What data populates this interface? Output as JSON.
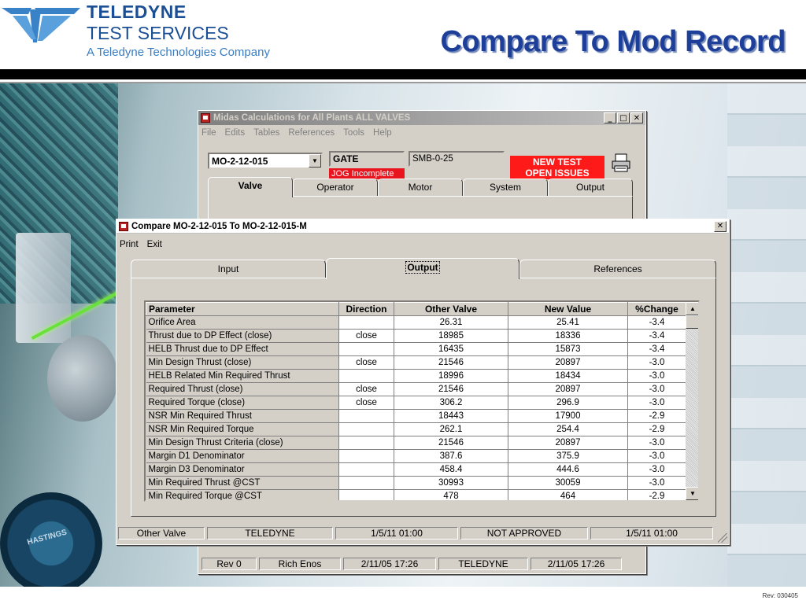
{
  "header": {
    "logo_line1": "TELEDYNE",
    "logo_line2": "TEST SERVICES",
    "logo_line3": "A Teledyne Technologies Company",
    "slide_title": "Compare To Mod Record",
    "revision": "Rev: 030405"
  },
  "background_art": {
    "dial_label": "HASTINGS"
  },
  "back_window": {
    "title": "Midas Calculations for All Plants ALL VALVES",
    "menu": [
      "File",
      "Edits",
      "Tables",
      "References",
      "Tools",
      "Help"
    ],
    "valve_id": "MO-2-12-015",
    "valve_type": "GATE",
    "jog_status": "JOG Incomplete",
    "model": "SMB-0-25",
    "alert_line1": "NEW TEST",
    "alert_line2": "OPEN ISSUES",
    "tabs": [
      "Valve",
      "Operator",
      "Motor",
      "System",
      "Output"
    ],
    "active_tab": "Valve",
    "status": [
      "Rev 0",
      "Rich Enos",
      "2/11/05 17:26",
      "TELEDYNE",
      "2/11/05 17:26"
    ]
  },
  "front_window": {
    "title": "Compare MO-2-12-015 To MO-2-12-015-M",
    "menu": [
      "Print",
      "Exit"
    ],
    "tabs": [
      "Input",
      "Output",
      "References"
    ],
    "active_tab": "Output",
    "columns": [
      "Parameter",
      "Direction",
      "Other Valve",
      "New Value",
      "%Change"
    ],
    "rows": [
      [
        "Orifice Area",
        "",
        "26.31",
        "25.41",
        "-3.4"
      ],
      [
        "Thrust due to DP Effect (close)",
        "close",
        "18985",
        "18336",
        "-3.4"
      ],
      [
        "HELB Thrust due to DP Effect",
        "",
        "16435",
        "15873",
        "-3.4"
      ],
      [
        "Min Design Thrust (close)",
        "close",
        "21546",
        "20897",
        "-3.0"
      ],
      [
        "HELB Related Min Required Thrust",
        "",
        "18996",
        "18434",
        "-3.0"
      ],
      [
        "Required Thrust (close)",
        "close",
        "21546",
        "20897",
        "-3.0"
      ],
      [
        "Required Torque (close)",
        "close",
        "306.2",
        "296.9",
        "-3.0"
      ],
      [
        "NSR Min Required Thrust",
        "",
        "18443",
        "17900",
        "-2.9"
      ],
      [
        "NSR Min Required Torque",
        "",
        "262.1",
        "254.4",
        "-2.9"
      ],
      [
        "Min Design Thrust Criteria (close)",
        "",
        "21546",
        "20897",
        "-3.0"
      ],
      [
        "Margin D1 Denominator",
        "",
        "387.6",
        "375.9",
        "-3.0"
      ],
      [
        "Margin D3 Denominator",
        "",
        "458.4",
        "444.6",
        "-3.0"
      ],
      [
        "Min Required Thrust @CST",
        "",
        "30993",
        "30059",
        "-3.0"
      ],
      [
        "Min Required Torque @CST",
        "",
        "478",
        "464",
        "-2.9"
      ]
    ],
    "status": [
      "Other Valve",
      "TELEDYNE",
      "1/5/11 01:00",
      "NOT APPROVED",
      "1/5/11 01:00"
    ]
  },
  "colors": {
    "title_blue": "#1d3f9a",
    "alert_red": "#ff1a1a",
    "jog_red": "#e8141e",
    "win_gray": "#d4d0c8"
  },
  "icons": [
    "teledyne-logo-icon",
    "app-icon",
    "printer-icon",
    "minimize-icon",
    "maximize-icon",
    "close-icon",
    "scroll-up-icon",
    "scroll-down-icon",
    "dropdown-arrow-icon",
    "resize-grip-icon"
  ]
}
